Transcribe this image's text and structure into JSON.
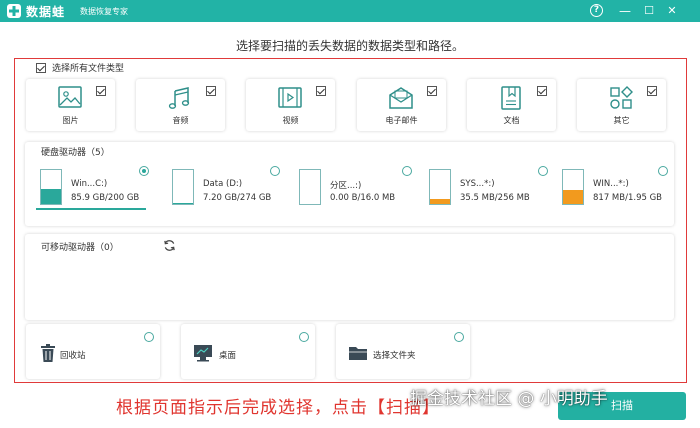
{
  "app": {
    "brand": "数据蛙",
    "subtitle": "数据恢复专家",
    "help": "?"
  },
  "window_controls": {
    "minimize": "—",
    "maximize": "☐",
    "close": "✕"
  },
  "instruction": "选择要扫描的丢失数据的数据类型和路径。",
  "select_all": {
    "label": "选择所有文件类型",
    "checked": true
  },
  "file_types": [
    {
      "label": "图片",
      "icon": "image-icon",
      "checked": true
    },
    {
      "label": "音频",
      "icon": "music-icon",
      "checked": true
    },
    {
      "label": "视频",
      "icon": "video-icon",
      "checked": true
    },
    {
      "label": "电子邮件",
      "icon": "mail-icon",
      "checked": true
    },
    {
      "label": "文档",
      "icon": "document-icon",
      "checked": true
    },
    {
      "label": "其它",
      "icon": "other-icon",
      "checked": true
    }
  ],
  "hard_drives": {
    "title": "硬盘驱动器（5）",
    "items": [
      {
        "name": "Win...C:)",
        "size": "85.9 GB/200 GB",
        "fill_pct": 43,
        "fill_color": "#2aa89b",
        "selected": true
      },
      {
        "name": "Data (D:)",
        "size": "7.20 GB/274 GB",
        "fill_pct": 3,
        "fill_color": "#2aa89b",
        "selected": false
      },
      {
        "name": "分区...:)",
        "size": "0.00  B/16.0 MB",
        "fill_pct": 0,
        "fill_color": "#2aa89b",
        "selected": false
      },
      {
        "name": "SYS...*:)",
        "size": "35.5 MB/256 MB",
        "fill_pct": 14,
        "fill_color": "#f29a1e",
        "selected": false
      },
      {
        "name": "WIN...*:)",
        "size": "817 MB/1.95 GB",
        "fill_pct": 42,
        "fill_color": "#f29a1e",
        "selected": false
      }
    ]
  },
  "removable": {
    "title": "可移动驱动器（0）",
    "refresh_icon": "refresh-icon"
  },
  "locations": [
    {
      "label": "回收站",
      "icon": "trash-icon"
    },
    {
      "label": "桌面",
      "icon": "desktop-icon"
    },
    {
      "label": "选择文件夹",
      "icon": "folder-icon"
    }
  ],
  "caption": "根据页面指示后完成选择，点击【扫描】",
  "watermark": "掘金技术社区 @ 小明助手",
  "scan_button": "扫描",
  "colors": {
    "accent": "#22b3a6",
    "frame": "#e03a3a",
    "caption": "#e0352f"
  }
}
